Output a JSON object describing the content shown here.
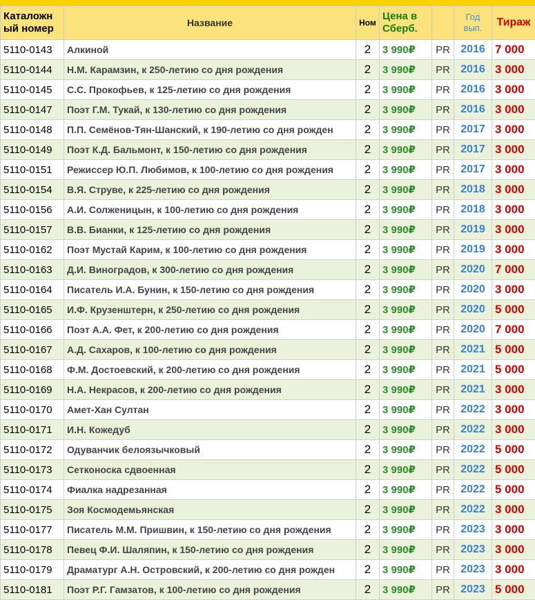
{
  "headers": {
    "catalog": "Каталожн ый номер",
    "name": "Название",
    "nom": "Ном",
    "price": "Цена в Сберб.",
    "extra": "",
    "year": "Год вып.",
    "tirazh": "Тираж"
  },
  "rows": [
    {
      "cat": "5110-0143",
      "name": "Алкиной",
      "nom": "2",
      "price": "3 990₽",
      "pr": "PR",
      "year": "2016",
      "tirazh": "7 000"
    },
    {
      "cat": "5110-0144",
      "name": "Н.М. Карамзин, к 250-летию со дня рождения",
      "nom": "2",
      "price": "3 990₽",
      "pr": "PR",
      "year": "2016",
      "tirazh": "3 000"
    },
    {
      "cat": "5110-0145",
      "name": "С.С. Прокофьев, к 125-летию со дня рождения",
      "nom": "2",
      "price": "3 990₽",
      "pr": "PR",
      "year": "2016",
      "tirazh": "3 000"
    },
    {
      "cat": "5110-0147",
      "name": "Поэт Г.М. Тукай, к 130-летию со дня рождения",
      "nom": "2",
      "price": "3 990₽",
      "pr": "PR",
      "year": "2016",
      "tirazh": "3 000"
    },
    {
      "cat": "5110-0148",
      "name": " П.П. Семёнов-Тян-Шанский, к 190-летию со дня рожден",
      "nom": "2",
      "price": "3 990₽",
      "pr": "PR",
      "year": "2017",
      "tirazh": "3 000"
    },
    {
      "cat": "5110-0149",
      "name": "Поэт К.Д. Бальмонт, к 150-летию со дня рождения",
      "nom": "2",
      "price": "3 990₽",
      "pr": "PR",
      "year": "2017",
      "tirazh": "3 000"
    },
    {
      "cat": "5110-0151",
      "name": "Режиссер Ю.П. Любимов, к 100-летию со дня рождения",
      "nom": "2",
      "price": "3 990₽",
      "pr": "PR",
      "year": "2017",
      "tirazh": "3 000"
    },
    {
      "cat": "5110-0154",
      "name": "В.Я. Струве, к 225-летию со дня рождения",
      "nom": "2",
      "price": "3 990₽",
      "pr": "PR",
      "year": "2018",
      "tirazh": "3 000"
    },
    {
      "cat": "5110-0156",
      "name": "А.И. Солженицын, к 100-летию со дня рождения",
      "nom": "2",
      "price": "3 990₽",
      "pr": "PR",
      "year": "2018",
      "tirazh": "3 000"
    },
    {
      "cat": "5110-0157",
      "name": "В.В. Бианки, к 125-летию со дня рождения",
      "nom": "2",
      "price": "3 990₽",
      "pr": "PR",
      "year": "2019",
      "tirazh": "3 000"
    },
    {
      "cat": "5110-0162",
      "name": "Поэт Мустай Карим, к 100-летию со дня рождения",
      "nom": "2",
      "price": "3 990₽",
      "pr": "PR",
      "year": "2019",
      "tirazh": "3 000"
    },
    {
      "cat": "5110-0163",
      "name": "Д.И. Виноградов, к 300-летию со дня рождения",
      "nom": "2",
      "price": "3 990₽",
      "pr": "PR",
      "year": "2020",
      "tirazh": "7 000"
    },
    {
      "cat": "5110-0164",
      "name": "Писатель И.А. Бунин, к 150-летию со дня рождения",
      "nom": "2",
      "price": "3 990₽",
      "pr": "PR",
      "year": "2020",
      "tirazh": "3 000"
    },
    {
      "cat": "5110-0165",
      "name": " И.Ф. Крузенштерн, к 250-летию со дня рождения",
      "nom": "2",
      "price": "3 990₽",
      "pr": "PR",
      "year": "2020",
      "tirazh": "5 000"
    },
    {
      "cat": "5110-0166",
      "name": "Поэт А.А. Фет, к 200-летию со дня рождения",
      "nom": "2",
      "price": "3 990₽",
      "pr": "PR",
      "year": "2020",
      "tirazh": "7 000"
    },
    {
      "cat": "5110-0167",
      "name": "А.Д. Сахаров, к 100-летию со дня рождения",
      "nom": "2",
      "price": "3 990₽",
      "pr": "PR",
      "year": "2021",
      "tirazh": "5 000"
    },
    {
      "cat": "5110-0168",
      "name": "Ф.М. Достоевский, к 200-летию со дня рождения",
      "nom": "2",
      "price": "3 990₽",
      "pr": "PR",
      "year": "2021",
      "tirazh": "5 000"
    },
    {
      "cat": "5110-0169",
      "name": " Н.А. Некрасов, к 200-летию со дня рождения",
      "nom": "2",
      "price": "3 990₽",
      "pr": "PR",
      "year": "2021",
      "tirazh": "3 000"
    },
    {
      "cat": "5110-0170",
      "name": "Амет-Хан Султан",
      "nom": "2",
      "price": "3 990₽",
      "pr": "PR",
      "year": "2022",
      "tirazh": "3 000"
    },
    {
      "cat": "5110-0171",
      "name": "И.Н. Кожедуб",
      "nom": "2",
      "price": "3 990₽",
      "pr": "PR",
      "year": "2022",
      "tirazh": "3 000"
    },
    {
      "cat": "5110-0172",
      "name": "Одуванчик белоязычковый",
      "nom": "2",
      "price": "3 990₽",
      "pr": "PR",
      "year": "2022",
      "tirazh": "5 000"
    },
    {
      "cat": "5110-0173",
      "name": "Сетконоска сдвоенная",
      "nom": "2",
      "price": "3 990₽",
      "pr": "PR",
      "year": "2022",
      "tirazh": "5 000"
    },
    {
      "cat": "5110-0174",
      "name": "Фиалка надрезанная",
      "nom": "2",
      "price": "3 990₽",
      "pr": "PR",
      "year": "2022",
      "tirazh": "5 000"
    },
    {
      "cat": "5110-0175",
      "name": "Зоя Космодемьянская",
      "nom": "2",
      "price": "3 990₽",
      "pr": "PR",
      "year": "2022",
      "tirazh": "3 000"
    },
    {
      "cat": "5110-0177",
      "name": "Писатель М.М. Пришвин, к 150-летию со дня рождения",
      "nom": "2",
      "price": "3 990₽",
      "pr": "PR",
      "year": "2023",
      "tirazh": "3 000"
    },
    {
      "cat": "5110-0178",
      "name": "Певец Ф.И. Шаляпин, к 150-летию со дня рождения",
      "nom": "2",
      "price": "3 990₽",
      "pr": "PR",
      "year": "2023",
      "tirazh": "3 000"
    },
    {
      "cat": "5110-0179",
      "name": "Драматург А.Н. Островский, к 200-летию со дня рожден",
      "nom": "2",
      "price": "3 990₽",
      "pr": "PR",
      "year": "2023",
      "tirazh": "3 000"
    },
    {
      "cat": "5110-0181",
      "name": "Поэт Р.Г. Гамзатов, к 100-летию со дня рождения",
      "nom": "2",
      "price": "3 990₽",
      "pr": "PR",
      "year": "2023",
      "tirazh": "5 000"
    }
  ]
}
